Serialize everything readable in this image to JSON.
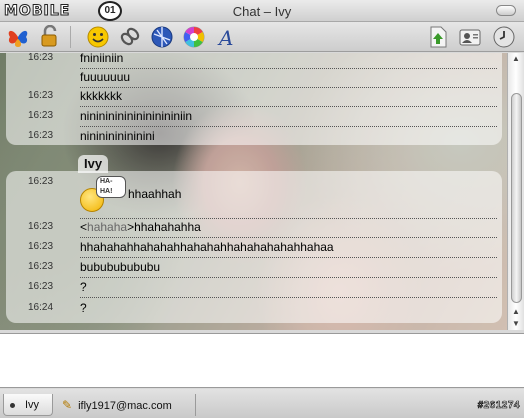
{
  "window": {
    "title": "Chat – Ivy",
    "watermark": "MOBILE",
    "watermark_badge": "01"
  },
  "toolbar": {
    "icons": [
      "buddy-butterfly-icon",
      "lock-icon",
      "smiley-icon",
      "link-icon",
      "globe-icon",
      "color-wheel-icon",
      "font-icon",
      "send-file-icon",
      "profile-card-icon",
      "history-clock-icon"
    ]
  },
  "chat": {
    "earlier_messages": [
      {
        "time": "16:23",
        "text": "fniniiniin"
      },
      {
        "time": "",
        "text": "fuuuuuuu"
      },
      {
        "time": "16:23",
        "text": "kkkkkkk"
      },
      {
        "time": "16:23",
        "text": "nininininininininininiin"
      },
      {
        "time": "16:23",
        "text": "nininininininini"
      }
    ],
    "sender": "Ivy",
    "smiley_first": {
      "time": "16:23",
      "speech": "HA-HA!",
      "text": "hhaahhah"
    },
    "link_message": {
      "time": "16:23",
      "prefix": "<",
      "highlight": "hahaha",
      "suffix": ">hhahahahha"
    },
    "later_messages": [
      {
        "time": "16:23",
        "text": "hhahahahhahahahhahahahhahahahahahhahaa"
      },
      {
        "time": "16:23",
        "text": "bubububububu"
      },
      {
        "time": "16:23",
        "text": "?"
      },
      {
        "time": "16:24",
        "text": "?"
      }
    ]
  },
  "input": {
    "value": ""
  },
  "tabs": [
    {
      "label": "Ivy",
      "active": true
    },
    {
      "label": "ifly1917@mac.com",
      "active": false
    }
  ],
  "footer_mark": "#261274",
  "colors": {
    "accent_green": "#3a9a2a",
    "link_gray": "#666666"
  }
}
